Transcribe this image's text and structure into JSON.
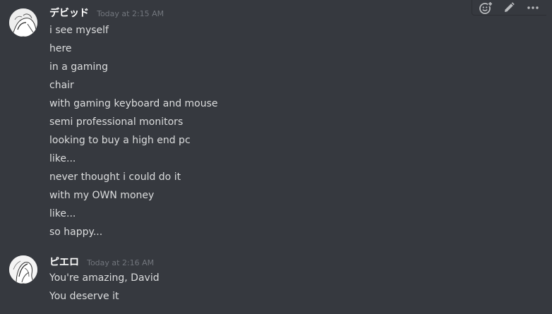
{
  "colors": {
    "background": "#36393f",
    "username": "#ffffff",
    "timestamp": "#72767d",
    "message_text": "#dcddde",
    "toolbar_icon": "#b9bbbe"
  },
  "toolbar": {
    "icons": [
      "add-reaction-icon",
      "edit-icon",
      "more-icon"
    ]
  },
  "messages": [
    {
      "username": "デビッド",
      "timestamp": "Today at 2:15 AM",
      "lines": [
        "i see myself",
        "here",
        "in a gaming",
        "chair",
        "with gaming keyboard and mouse",
        "semi professional monitors",
        "looking to buy a high end pc",
        "like...",
        "never thought i could do it",
        "with my OWN money",
        "like...",
        "so happy..."
      ]
    },
    {
      "username": "ピエロ",
      "timestamp": "Today at 2:16 AM",
      "lines": [
        "You're amazing, David",
        "You deserve it"
      ]
    }
  ]
}
